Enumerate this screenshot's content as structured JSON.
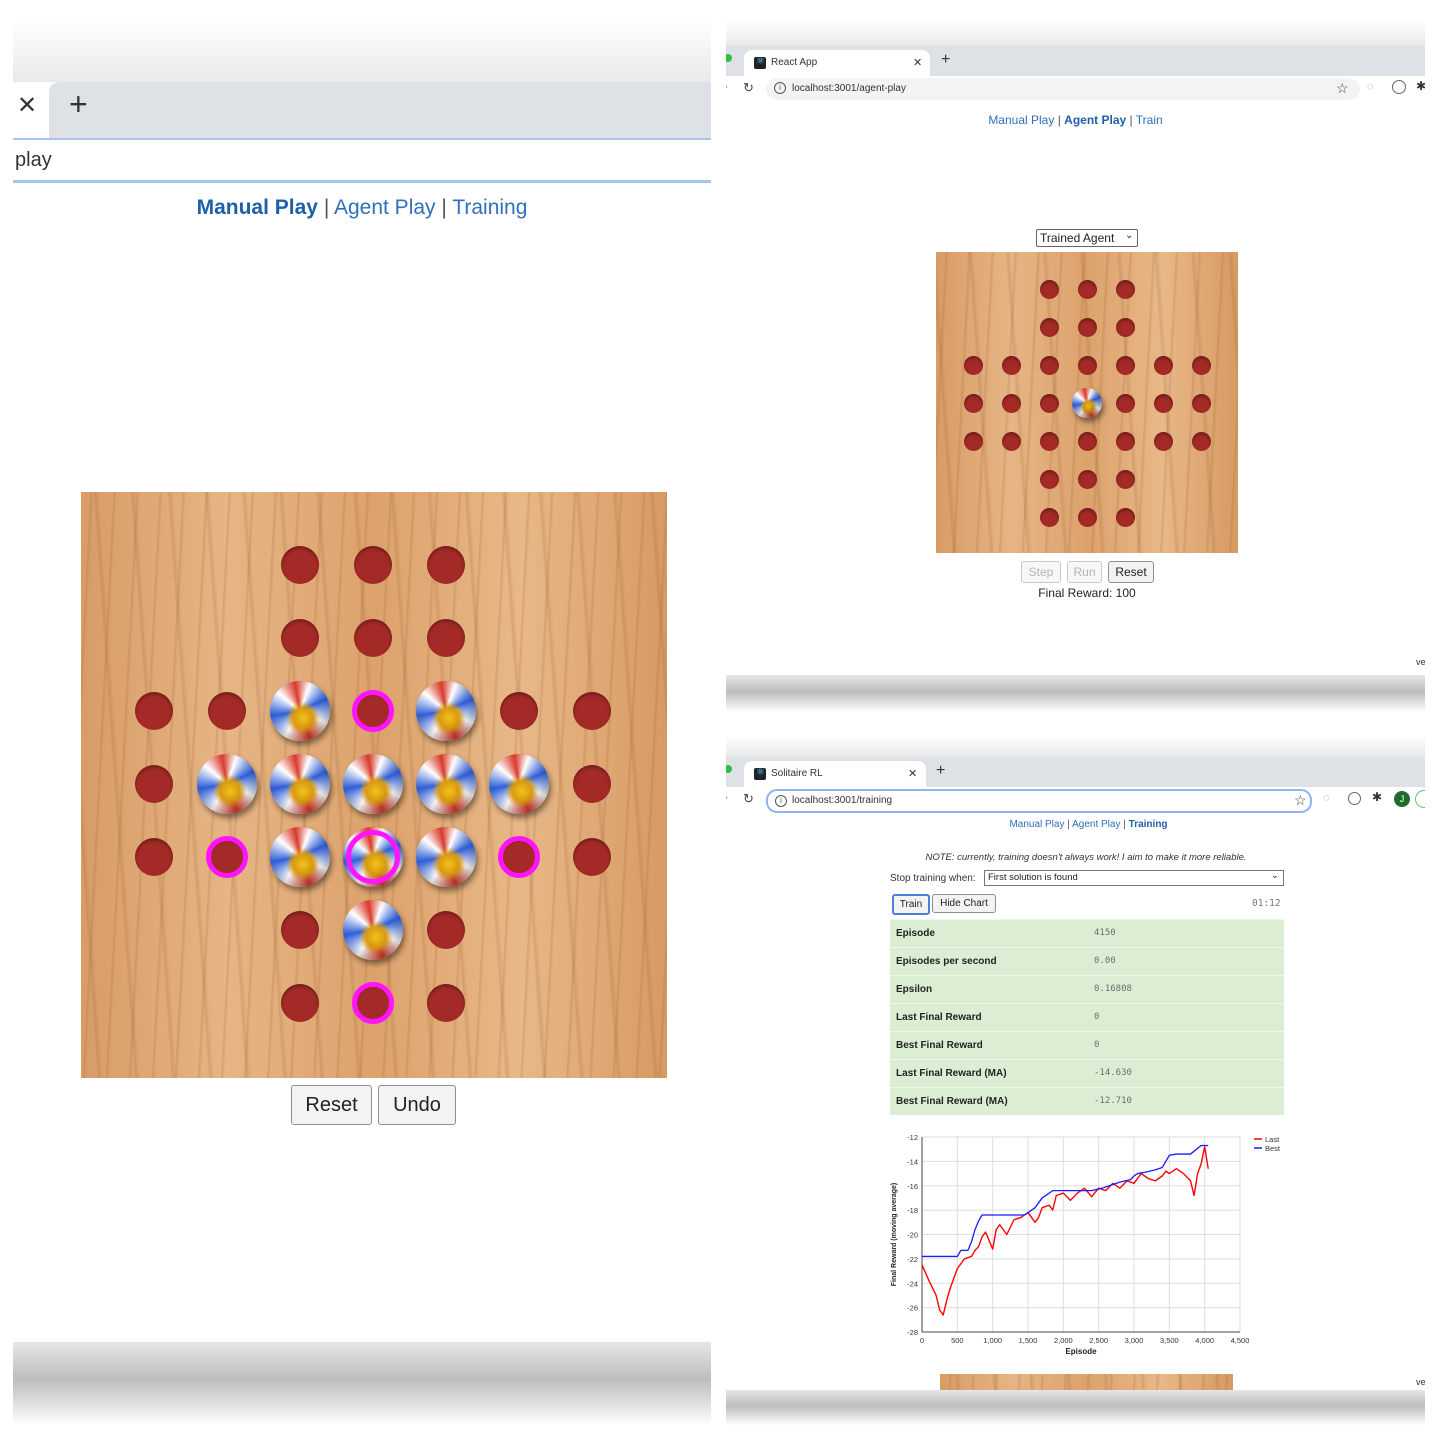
{
  "manual": {
    "address_text": "play",
    "nav": {
      "manual": "Manual Play",
      "agent": "Agent Play",
      "training": "Training",
      "sep": "|"
    },
    "buttons": {
      "reset": "Reset",
      "undo": "Undo"
    }
  },
  "agent": {
    "tab_title": "React App",
    "url": "localhost:3001/agent-play",
    "nav": {
      "manual": "Manual Play",
      "agent": "Agent Play",
      "train": "Train",
      "sep": "|"
    },
    "select_value": "Trained Agent",
    "buttons": {
      "step": "Step",
      "run": "Run",
      "reset": "Reset"
    },
    "final_reward": "Final Reward: 100",
    "edge_text": "ve"
  },
  "training": {
    "tab_title": "Solitaire RL",
    "url": "localhost:3001/training",
    "avatar_letter": "J",
    "nav": {
      "manual": "Manual Play",
      "agent": "Agent Play",
      "training": "Training",
      "sep": "|"
    },
    "note": "NOTE: currently, training doesn't always work! I aim to make it more reliable.",
    "stop_label": "Stop training when:",
    "stop_value": "First solution is found",
    "buttons": {
      "train": "Train",
      "hide_chart": "Hide Chart"
    },
    "timer": "01:12",
    "stats": [
      {
        "label": "Episode",
        "value": "4150"
      },
      {
        "label": "Episodes per second",
        "value": "0.00"
      },
      {
        "label": "Epsilon",
        "value": "0.16808"
      },
      {
        "label": "Last Final Reward",
        "value": "0"
      },
      {
        "label": "Best Final Reward",
        "value": "0"
      },
      {
        "label": "Last Final Reward (MA)",
        "value": "-14.630"
      },
      {
        "label": "Best Final Reward (MA)",
        "value": "-12.710"
      }
    ],
    "edge_text": "ve"
  },
  "colors": {
    "link": "#2f6fbd",
    "hole": "#a32a26",
    "highlight": "#ff14ff",
    "stats_bg": "#dbeed3",
    "series_last": "#ff0000",
    "series_best": "#1a1aff"
  },
  "chart_data": {
    "type": "line",
    "xlabel": "Episode",
    "ylabel": "Final Reward (moving average)",
    "xlim": [
      0,
      4500
    ],
    "ylim": [
      -28,
      -12
    ],
    "xticks": [
      "0",
      "500",
      "1,000",
      "1,500",
      "2,000",
      "2,500",
      "3,000",
      "3,500",
      "4,000",
      "4,500"
    ],
    "yticks": [
      "-12",
      "-14",
      "-16",
      "-18",
      "-20",
      "-22",
      "-24",
      "-26",
      "-28"
    ],
    "grid": true,
    "legend_position": "top-right",
    "series": [
      {
        "name": "Last",
        "color": "#ff0000",
        "x": [
          0,
          100,
          200,
          250,
          300,
          350,
          400,
          450,
          500,
          550,
          600,
          700,
          750,
          800,
          850,
          900,
          1000,
          1050,
          1100,
          1150,
          1200,
          1300,
          1400,
          1500,
          1600,
          1650,
          1700,
          1800,
          1850,
          1900,
          2000,
          2100,
          2200,
          2300,
          2400,
          2500,
          2600,
          2700,
          2800,
          2900,
          3000,
          3100,
          3200,
          3300,
          3400,
          3450,
          3500,
          3600,
          3700,
          3800,
          3850,
          3900,
          3950,
          4000,
          4050
        ],
        "y": [
          -22.5,
          -23.8,
          -25.0,
          -26.2,
          -26.6,
          -25.4,
          -24.4,
          -23.6,
          -22.8,
          -22.4,
          -22.0,
          -21.8,
          -21.3,
          -21.0,
          -20.2,
          -19.8,
          -21.2,
          -19.6,
          -19.2,
          -19.6,
          -20.0,
          -18.8,
          -18.6,
          -18.2,
          -19.0,
          -18.6,
          -17.8,
          -17.6,
          -18.0,
          -16.8,
          -16.6,
          -17.2,
          -16.6,
          -16.2,
          -16.9,
          -16.2,
          -16.4,
          -15.8,
          -16.2,
          -15.6,
          -15.8,
          -15.0,
          -15.4,
          -15.6,
          -15.2,
          -14.8,
          -15.0,
          -14.6,
          -15.0,
          -15.6,
          -16.8,
          -15.0,
          -14.2,
          -12.8,
          -14.6
        ]
      },
      {
        "name": "Best",
        "color": "#1a1aff",
        "x": [
          0,
          500,
          550,
          650,
          700,
          750,
          800,
          850,
          950,
          1100,
          1200,
          1300,
          1450,
          1600,
          1700,
          1850,
          1950,
          2050,
          2400,
          2550,
          2700,
          2800,
          2950,
          3000,
          3050,
          3150,
          3300,
          3400,
          3500,
          3600,
          3700,
          3800,
          3950,
          4050
        ],
        "y": [
          -21.8,
          -21.8,
          -21.3,
          -21.3,
          -20.6,
          -19.6,
          -18.9,
          -18.4,
          -18.4,
          -18.4,
          -18.4,
          -18.4,
          -18.4,
          -17.8,
          -17.0,
          -16.4,
          -16.4,
          -16.4,
          -16.4,
          -16.2,
          -15.9,
          -15.7,
          -15.5,
          -15.2,
          -15.0,
          -14.9,
          -14.7,
          -14.5,
          -13.5,
          -13.4,
          -13.4,
          -13.4,
          -12.7,
          -12.7
        ]
      }
    ]
  }
}
